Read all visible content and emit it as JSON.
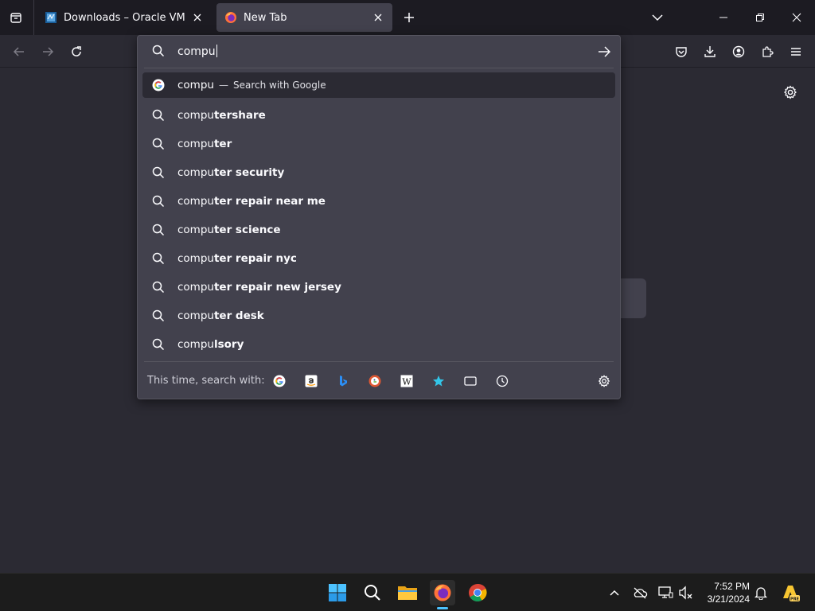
{
  "tabs": [
    {
      "title": "Downloads – Oracle VM VirtualBox",
      "icon": "virtualbox-icon"
    },
    {
      "title": "New Tab",
      "icon": "firefox-icon",
      "active": true
    }
  ],
  "urlbar": {
    "typed": "compu",
    "first_result": {
      "text": "compu",
      "action": "Search with Google"
    },
    "suggestions": [
      {
        "typed": "compu",
        "rest": "tershare"
      },
      {
        "typed": "compu",
        "rest": "ter"
      },
      {
        "typed": "compu",
        "rest": "ter security"
      },
      {
        "typed": "compu",
        "rest": "ter repair near me"
      },
      {
        "typed": "compu",
        "rest": "ter science"
      },
      {
        "typed": "compu",
        "rest": "ter repair nyc"
      },
      {
        "typed": "compu",
        "rest": "ter repair new jersey"
      },
      {
        "typed": "compu",
        "rest": "ter desk"
      },
      {
        "typed": "compu",
        "rest": "lsory"
      }
    ],
    "oneoff_label": "This time, search with:",
    "engines": [
      "google-icon",
      "amazon-icon",
      "bing-icon",
      "duckduckgo-icon",
      "wikipedia-icon",
      "bookmarks-icon",
      "tabs-icon",
      "history-icon"
    ]
  },
  "taskbar": {
    "time": "7:52 PM",
    "date": "3/21/2024"
  },
  "colors": {
    "background": "#2b2a33",
    "dropdown": "#42414d",
    "tabbar": "#1c1b22",
    "accent": "#4cc2ff"
  }
}
